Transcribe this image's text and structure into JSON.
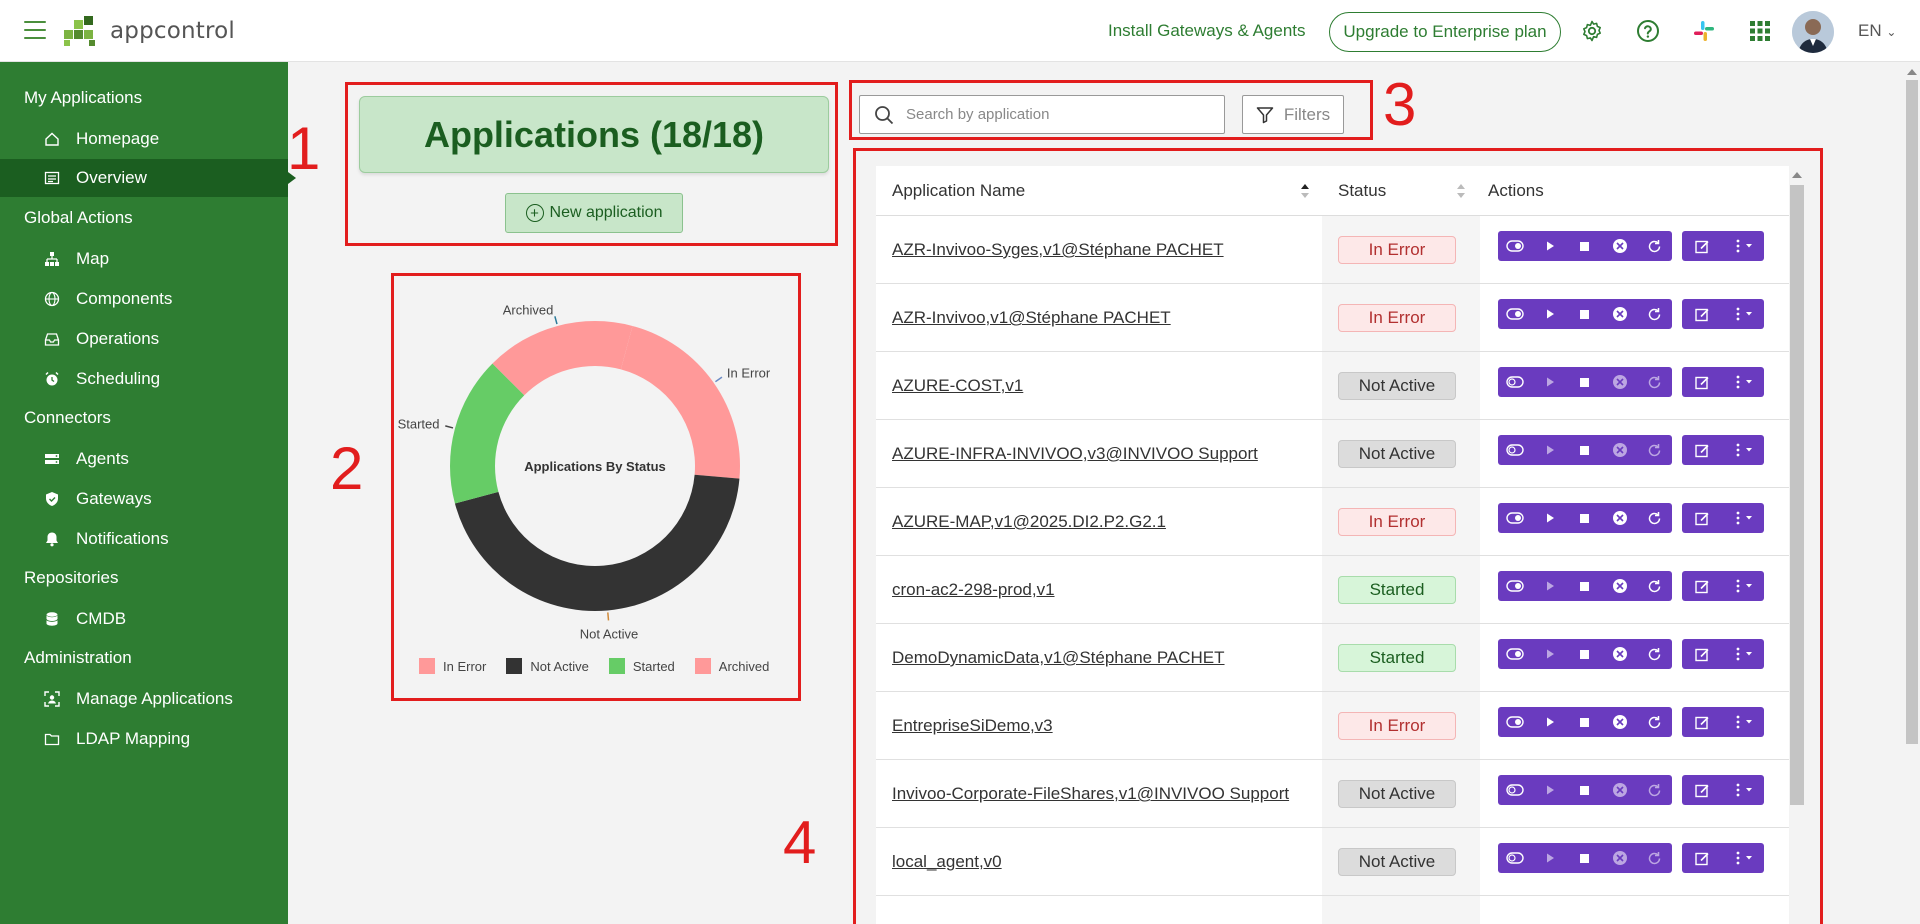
{
  "header": {
    "logo_text": "appcontrol",
    "install_link": "Install Gateways & Agents",
    "upgrade_label": "Upgrade to Enterprise plan",
    "language": "EN",
    "icons": [
      "menu-icon",
      "settings-icon",
      "help-icon",
      "slack-icon",
      "apps-grid-icon",
      "avatar"
    ]
  },
  "sidebar": {
    "sections": [
      {
        "title": "My Applications",
        "items": [
          {
            "label": "Homepage",
            "icon": "home-icon"
          },
          {
            "label": "Overview",
            "icon": "list-icon",
            "active": true
          }
        ]
      },
      {
        "title": "Global Actions",
        "items": [
          {
            "label": "Map",
            "icon": "hierarchy-icon"
          },
          {
            "label": "Components",
            "icon": "globe-icon"
          },
          {
            "label": "Operations",
            "icon": "inbox-icon"
          },
          {
            "label": "Scheduling",
            "icon": "alarm-icon"
          }
        ]
      },
      {
        "title": "Connectors",
        "items": [
          {
            "label": "Agents",
            "icon": "server-icon"
          },
          {
            "label": "Gateways",
            "icon": "shield-icon"
          },
          {
            "label": "Notifications",
            "icon": "bell-icon"
          }
        ]
      },
      {
        "title": "Repositories",
        "items": [
          {
            "label": "CMDB",
            "icon": "database-icon"
          }
        ]
      },
      {
        "title": "Administration",
        "items": [
          {
            "label": "Manage Applications",
            "icon": "user-frame-icon"
          },
          {
            "label": "LDAP Mapping",
            "icon": "folder-icon"
          }
        ]
      }
    ]
  },
  "annotations": [
    "1",
    "2",
    "3",
    "4"
  ],
  "applications": {
    "title": "Applications (18/18)",
    "new_button": "New application"
  },
  "chart_data": {
    "type": "pie",
    "title": "Applications By Status",
    "categories": [
      "In Error",
      "Not Active",
      "Started",
      "Archived"
    ],
    "values": [
      4,
      8,
      3,
      3
    ],
    "colors": [
      "#ff9999",
      "#333333",
      "#66cc66",
      "#ff9999"
    ],
    "legend": "bottom",
    "slice_labels": [
      "In Error",
      "Not Active",
      "Started",
      "Archived"
    ]
  },
  "search": {
    "placeholder": "Search by application",
    "filters_label": "Filters"
  },
  "table": {
    "headers": {
      "name": "Application Name",
      "status": "Status",
      "actions": "Actions"
    },
    "rows": [
      {
        "name": "AZR-Invivoo-Syges,v1@Stéphane PACHET",
        "status": "In Error",
        "kind": "error"
      },
      {
        "name": "AZR-Invivoo,v1@Stéphane PACHET",
        "status": "In Error",
        "kind": "error"
      },
      {
        "name": "AZURE-COST,v1",
        "status": "Not Active",
        "kind": "inactive"
      },
      {
        "name": "AZURE-INFRA-INVIVOO,v3@INVIVOO Support",
        "status": "Not Active",
        "kind": "inactive"
      },
      {
        "name": "AZURE-MAP,v1@2025.DI2.P2.G2.1",
        "status": "In Error",
        "kind": "error"
      },
      {
        "name": "cron-ac2-298-prod,v1",
        "status": "Started",
        "kind": "started"
      },
      {
        "name": "DemoDynamicData,v1@Stéphane PACHET",
        "status": "Started",
        "kind": "started"
      },
      {
        "name": "EntrepriseSiDemo,v3",
        "status": "In Error",
        "kind": "error"
      },
      {
        "name": "Invivoo-Corporate-FileShares,v1@INVIVOO Support",
        "status": "Not Active",
        "kind": "inactive"
      },
      {
        "name": "local_agent,v0",
        "status": "Not Active",
        "kind": "inactive"
      }
    ]
  }
}
